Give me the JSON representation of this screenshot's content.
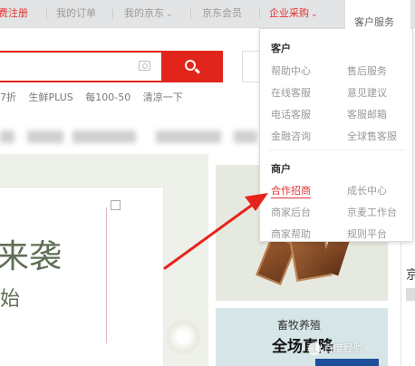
{
  "topbar": {
    "register": "费注册",
    "my_orders": "我的订单",
    "my_jd": "我的京东",
    "jd_member": "京东会员",
    "enterprise": "企业采购",
    "service": "客户服务"
  },
  "search": {
    "value": "",
    "hot_words": [
      "7折",
      "生鲜PLUS",
      "每100-50",
      "清凉一下"
    ]
  },
  "dropdown": {
    "customer_heading": "客户",
    "customer_links": [
      "帮助中心",
      "售后服务",
      "在线客服",
      "意见建议",
      "电话客服",
      "客服邮箱",
      "金融咨询",
      "全球售客服"
    ],
    "merchant_heading": "商户",
    "merchant_links": [
      "合作招商",
      "成长中心",
      "商家后台",
      "京麦工作台",
      "商家帮助",
      "规则平台"
    ]
  },
  "banner": {
    "headline": "来袭",
    "subline": "始"
  },
  "promo": {
    "line1": "畜牧养殖",
    "line2": "全场直降"
  },
  "right_col_char": "京",
  "watermark": "百度经验",
  "colors": {
    "accent_red": "#e1251b",
    "topbar_bg": "#e3e4e5",
    "highlight_red": "#e33333"
  },
  "icons": {
    "camera": "camera-icon",
    "search": "search-icon",
    "caret": "chevron-down-icon"
  }
}
